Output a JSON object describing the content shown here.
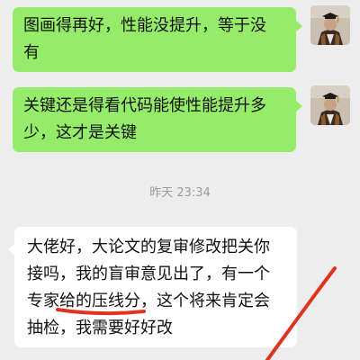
{
  "messages": [
    {
      "sender": "self",
      "text": "图画得再好，性能没提升，等于没\n有"
    },
    {
      "sender": "self",
      "text": "关键还是得看代码能使性能提升多\n少，这才是关键"
    },
    {
      "sender": "other",
      "text": "大佬好，大论文的复审修改把关你\n接吗，我的盲审意见出了，有一个\n专家给的压线分，这个将来肯定会\n抽检，我需要好好改"
    }
  ],
  "timestamp": "昨天 23:34",
  "colors": {
    "background": "#ededed",
    "outgoing_bubble": "#95ec69",
    "incoming_bubble": "#ffffff",
    "annotation": "#e0331f"
  },
  "icons": [
    "avatar-portrait"
  ]
}
